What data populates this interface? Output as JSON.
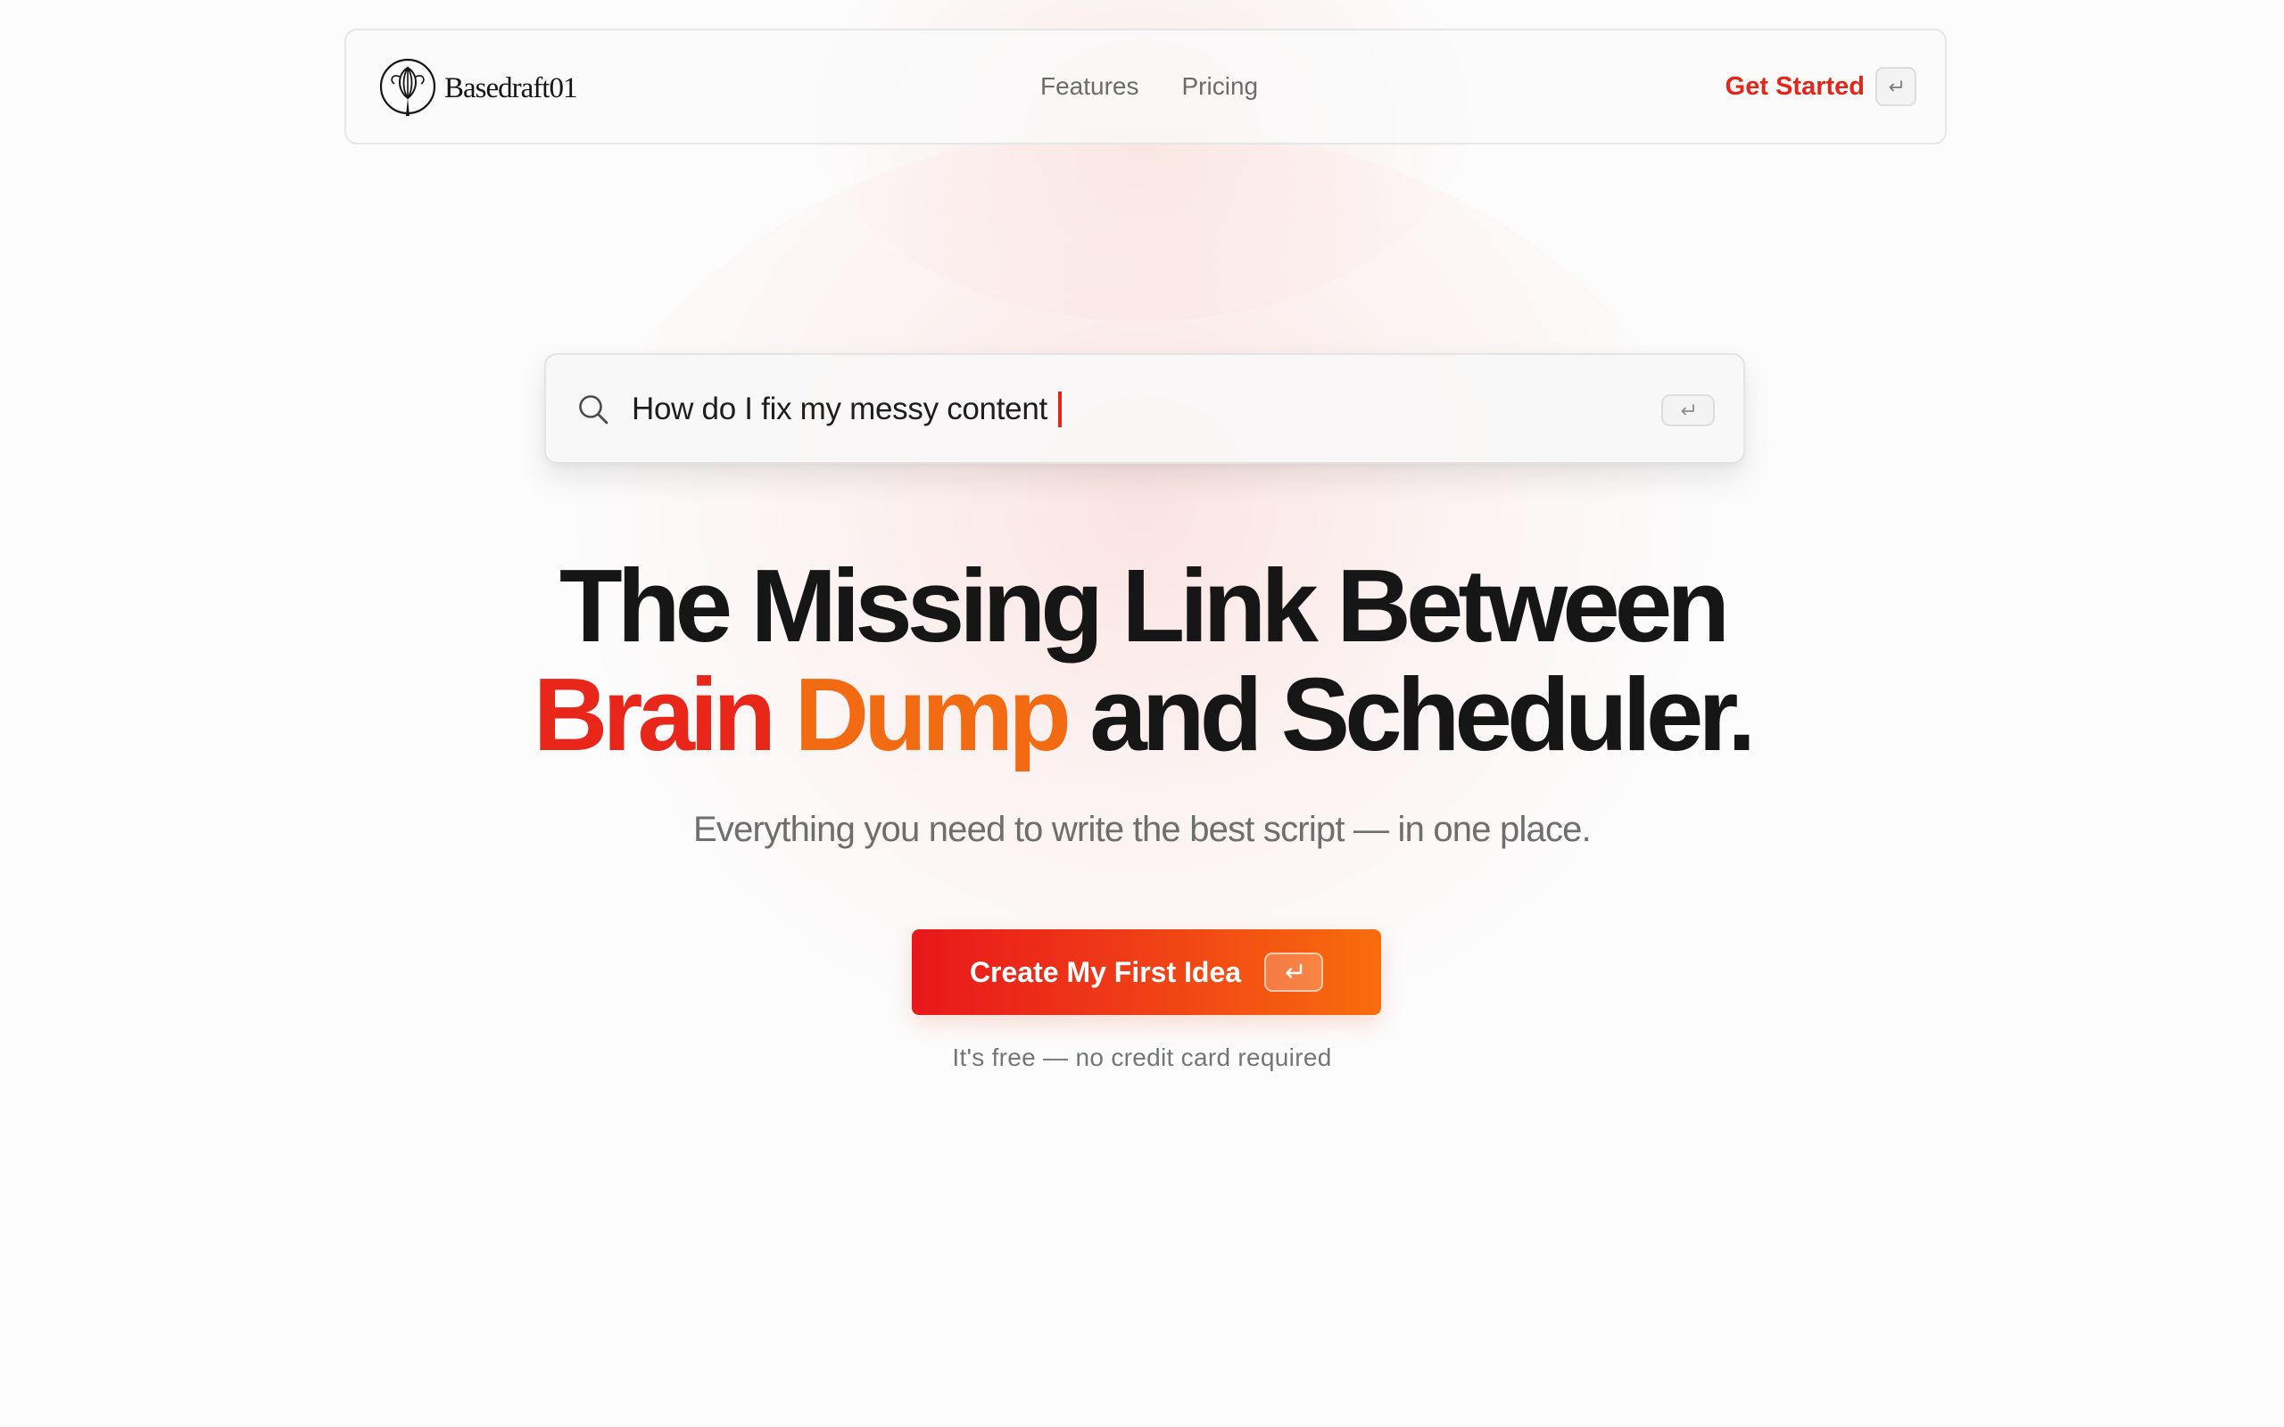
{
  "brand": {
    "name": "Basedraft01",
    "logo_icon": "whisk-logo-icon"
  },
  "nav": {
    "links": [
      "Features",
      "Pricing"
    ],
    "cta_label": "Get Started",
    "cta_key_icon": "enter-key-icon"
  },
  "search": {
    "value": "How do I fix my messy content",
    "icon": "search-icon",
    "key_icon": "enter-key-icon"
  },
  "hero": {
    "headline_line1": "The Missing Link Between",
    "headline_brain": "Brain",
    "headline_dump": "Dump",
    "headline_rest": "and Scheduler.",
    "subtitle": "Everything you need to write the best script — in one place.",
    "cta_label": "Create My First Idea",
    "cta_key_icon": "enter-key-icon",
    "note": "It's free — no credit card required"
  },
  "colors": {
    "accent_red": "#e8261a",
    "accent_orange": "#f26b12",
    "text_dark": "#161616",
    "text_muted": "#6e6e6e"
  }
}
